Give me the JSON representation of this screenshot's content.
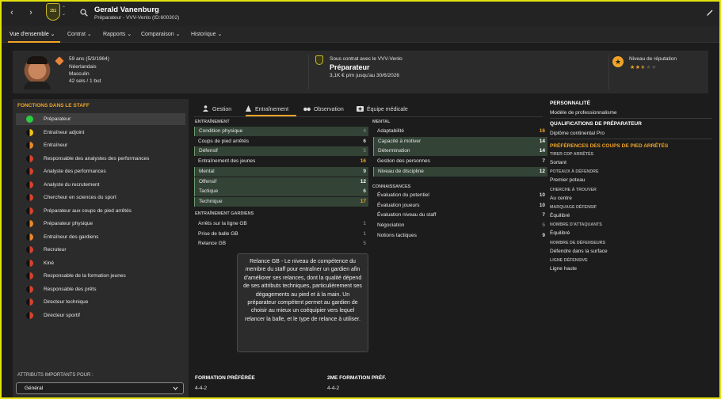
{
  "colors": {
    "accent": "#f0a428",
    "highlight_row": "#334336",
    "border": "#e3e30c"
  },
  "topbar": {
    "badge_text": "151",
    "name": "Gerald Vanenburg",
    "subtitle": "Préparateur - VVV-Venlo (ID:600302)"
  },
  "menu": [
    {
      "label": "Vue d'ensemble"
    },
    {
      "label": "Contrat"
    },
    {
      "label": "Rapports"
    },
    {
      "label": "Comparaison"
    },
    {
      "label": "Historique"
    }
  ],
  "header": {
    "age": "59 ans (5/3/1964)",
    "nationality": "Néerlandais",
    "gender": "Masculin",
    "caps": "42 sels / 1 but",
    "contract_label": "Sous contrat avec le VVV-Venlo",
    "role": "Préparateur",
    "salary": "3,1K € p/m jusqu'au 30/6/2026",
    "reputation_label": "Niveau de réputation",
    "reputation_stars": "2.5 of 5"
  },
  "staff_roles": {
    "title": "FONCTIONS DANS LE STAFF",
    "items": [
      {
        "label": "Préparateur",
        "level": "full"
      },
      {
        "label": "Entraîneur adjoint",
        "level": "half-yellow"
      },
      {
        "label": "Entraîneur",
        "level": "half-orange"
      },
      {
        "label": "Responsable des analystes des performances",
        "level": "half-red"
      },
      {
        "label": "Analyste des performances",
        "level": "half-red"
      },
      {
        "label": "Analyste du recrutement",
        "level": "half-red"
      },
      {
        "label": "Chercheur en sciences du sport",
        "level": "half-red"
      },
      {
        "label": "Préparateur aux coups de pied arrêtés",
        "level": "half-red"
      },
      {
        "label": "Préparateur physique",
        "level": "half-orange"
      },
      {
        "label": "Entraîneur des gardiens",
        "level": "half-orange"
      },
      {
        "label": "Recruteur",
        "level": "half-red"
      },
      {
        "label": "Kiné",
        "level": "half-red"
      },
      {
        "label": "Responsable de la formation jeunes",
        "level": "half-red"
      },
      {
        "label": "Responsable des prêts",
        "level": "half-red"
      },
      {
        "label": "Directeur technique",
        "level": "half-red"
      },
      {
        "label": "Directeur sportif",
        "level": "half-red"
      }
    ],
    "important_label": "ATTRIBUTS IMPORTANTS POUR :",
    "dropdown_value": "Général"
  },
  "tabs": [
    {
      "label": "Gestion"
    },
    {
      "label": "Entraînement"
    },
    {
      "label": "Observation"
    },
    {
      "label": "Équipe médicale"
    }
  ],
  "training": {
    "title": "ENTRAÎNEMENT",
    "items": [
      {
        "name": "Condition physique",
        "value": "4",
        "hl": true
      },
      {
        "name": "Coups de pied arrêtés",
        "value": "6",
        "hl": false
      },
      {
        "name": "Défensif",
        "value": "5",
        "hl": true
      },
      {
        "name": "Entraînement des jeunes",
        "value": "16",
        "hl": false
      },
      {
        "name": "Mental",
        "value": "9",
        "hl": true
      },
      {
        "name": "Offensif",
        "value": "12",
        "hl": true
      },
      {
        "name": "Tactique",
        "value": "6",
        "hl": true
      },
      {
        "name": "Technique",
        "value": "17",
        "hl": true
      }
    ]
  },
  "gk_training": {
    "title": "ENTRAÎNEMENT GARDIENS",
    "items": [
      {
        "name": "Arrêts sur la ligne GB",
        "value": "1"
      },
      {
        "name": "Prise de balle GB",
        "value": "1"
      },
      {
        "name": "Relance GB",
        "value": "5"
      }
    ]
  },
  "mental": {
    "title": "MENTAL",
    "items": [
      {
        "name": "Adaptabilité",
        "value": "16",
        "hl": false
      },
      {
        "name": "Capacité à motiver",
        "value": "14",
        "hl": true
      },
      {
        "name": "Détermination",
        "value": "14",
        "hl": true
      },
      {
        "name": "Gestion des personnes",
        "value": "7",
        "hl": false
      },
      {
        "name": "Niveau de discipline",
        "value": "12",
        "hl": true
      }
    ]
  },
  "knowledge": {
    "title": "CONNAISSANCES",
    "items": [
      {
        "name": "Évaluation du potentiel",
        "value": "10"
      },
      {
        "name": "Évaluation joueurs",
        "value": "10"
      },
      {
        "name": "Évaluation niveau du staff",
        "value": "7"
      },
      {
        "name": "Négociation",
        "value": "5"
      },
      {
        "name": "Notions tactiques",
        "value": "9"
      }
    ]
  },
  "tooltip": "Relance GB - Le niveau de compétence du membre du staff pour entraîner un gardien afin d'améliorer ses relances, dont la qualité dépend de ses attributs techniques, particulièrement ses dégagements au pied et à la main. Un préparateur compétent permet au gardien de choisir au mieux un coéquipier vers lequel relancer la balle, et le type de relance à utiliser.",
  "formation": {
    "pref_label": "FORMATION PRÉFÉRÉE",
    "pref_value": "4-4-2",
    "second_label": "2ME FORMATION PRÉF.",
    "second_value": "4-4-2"
  },
  "right": {
    "personality_title": "PERSONNALITÉ",
    "personality_value": "Modèle de professionnalisme",
    "qual_title": "QUALIFICATIONS DE PRÉPARATEUR",
    "qual_value": "Diplôme continental Pro",
    "setpiece_title": "PRÉFÉRENCES DES COUPS DE PIED ARRÊTÉS",
    "prefs": [
      {
        "label": "TIRER CDP ARRÊTÉS",
        "value": "Sortant"
      },
      {
        "label": "POTEAUX À DÉFENDRE",
        "value": "Premier poteau"
      },
      {
        "label": "CHERCHE À TROUVER",
        "value": "Au centre"
      },
      {
        "label": "MARQUAGE DÉFENSIF",
        "value": "Équilibré"
      },
      {
        "label": "NOMBRE D'ATTAQUANTS",
        "value": "Équilibré"
      },
      {
        "label": "NOMBRE DE DÉFENSEURS",
        "value": "Défendre dans la surface"
      },
      {
        "label": "LIGNE DÉFENSIVE",
        "value": "Ligne haute"
      }
    ]
  }
}
